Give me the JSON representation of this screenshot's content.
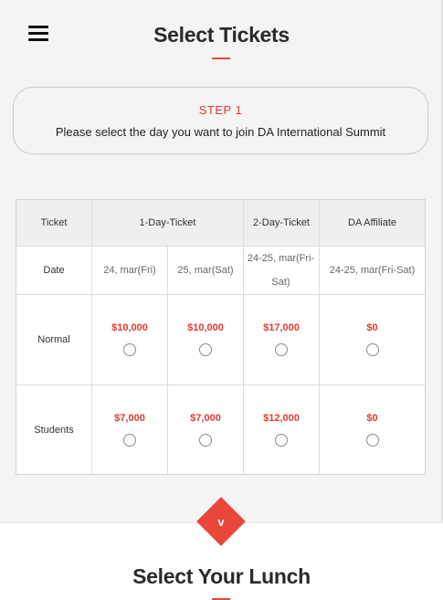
{
  "header": {
    "title": "Select Tickets"
  },
  "step": {
    "label": "STEP 1",
    "description": "Please select the day you want to join DA International Summit"
  },
  "table": {
    "headers": {
      "ticket": "Ticket",
      "one_day": "1-Day-Ticket",
      "two_day": "2-Day-Ticket",
      "affiliate": "DA Affiliate"
    },
    "date_row": {
      "label": "Date",
      "day1": "24, mar(Fri)",
      "day2": "25, mar(Sat)",
      "two_day": "24-25, mar(Fri-Sat)",
      "affiliate": "24-25, mar(Fri-Sat)"
    },
    "rows": [
      {
        "label": "Normal",
        "prices": [
          "$10,000",
          "$10,000",
          "$17,000",
          "$0"
        ]
      },
      {
        "label": "Students",
        "prices": [
          "$7,000",
          "$7,000",
          "$12,000",
          "$0"
        ]
      }
    ]
  },
  "next_section": {
    "toggle_glyph": "v",
    "title": "Select Your Lunch"
  },
  "colors": {
    "accent": "#e8473a",
    "price": "#e23a2e"
  }
}
